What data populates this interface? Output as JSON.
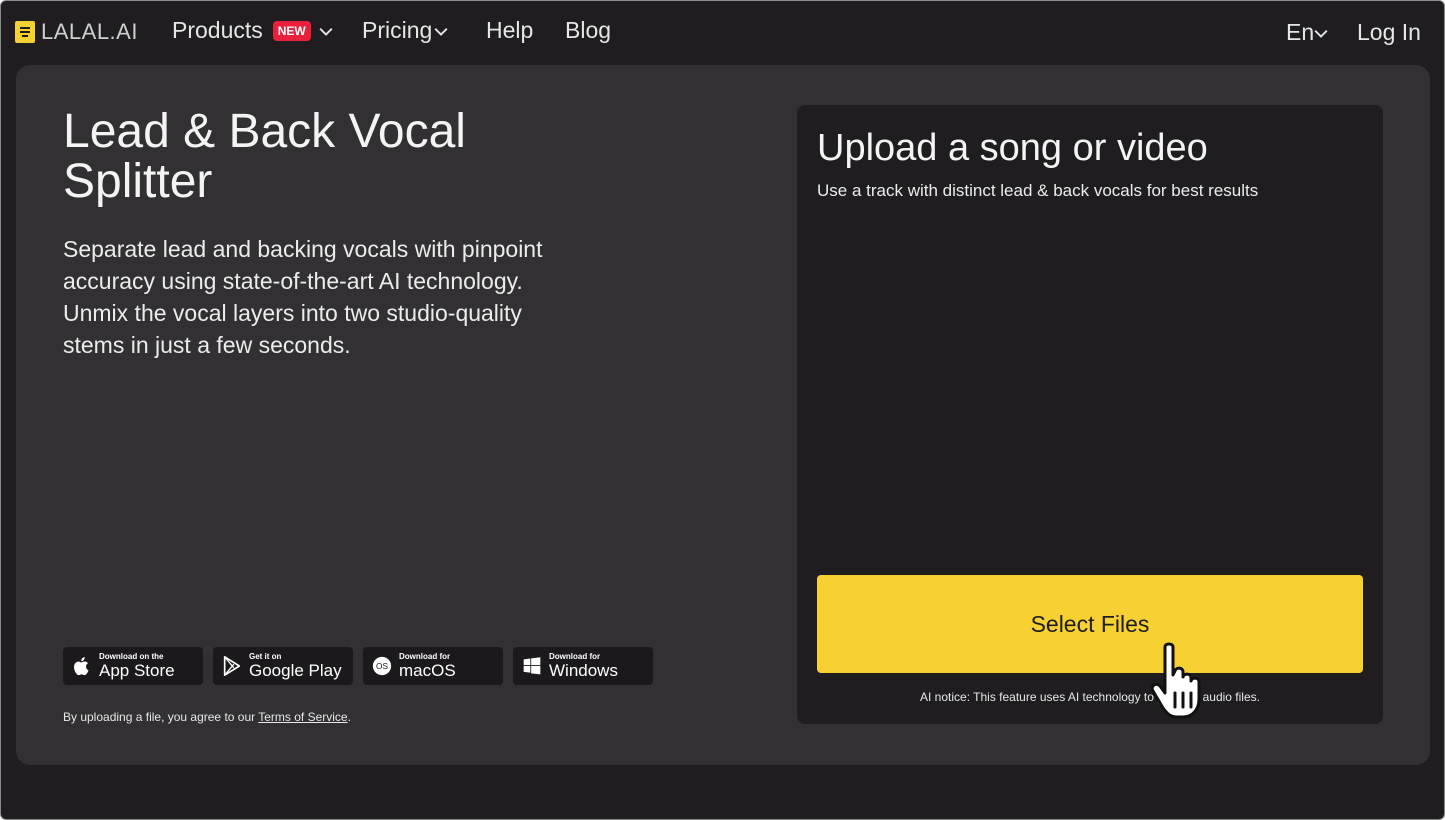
{
  "nav": {
    "logo": "LALAL.AI",
    "products": "Products",
    "products_badge": "NEW",
    "pricing": "Pricing",
    "help": "Help",
    "blog": "Blog",
    "language": "En",
    "login": "Log In"
  },
  "hero": {
    "title": "Lead & Back Vocal Splitter",
    "description": "Separate lead and backing vocals with pinpoint accuracy using state-of-the-art AI technology. Unmix the vocal layers into two studio-quality stems in just a few seconds."
  },
  "stores": [
    {
      "small": "Download on the",
      "big": "App Store",
      "icon": "apple-icon"
    },
    {
      "small": "Get it on",
      "big": "Google Play",
      "icon": "google-play-icon"
    },
    {
      "small": "Download for",
      "big": "macOS",
      "icon": "macos-icon"
    },
    {
      "small": "Download for",
      "big": "Windows",
      "icon": "windows-icon"
    }
  ],
  "tos": {
    "prefix": "By uploading a file, you agree to our ",
    "link": "Terms of Service",
    "suffix": "."
  },
  "upload": {
    "title": "Upload a song or video",
    "subtitle": "Use a track with distinct lead & back vocals for best results",
    "button": "Select Files",
    "notice": "AI notice: This feature uses AI technology to process audio files."
  },
  "colors": {
    "accent": "#f6d131",
    "badge": "#e8203c",
    "background": "#1f1d20",
    "card": "#323033"
  }
}
